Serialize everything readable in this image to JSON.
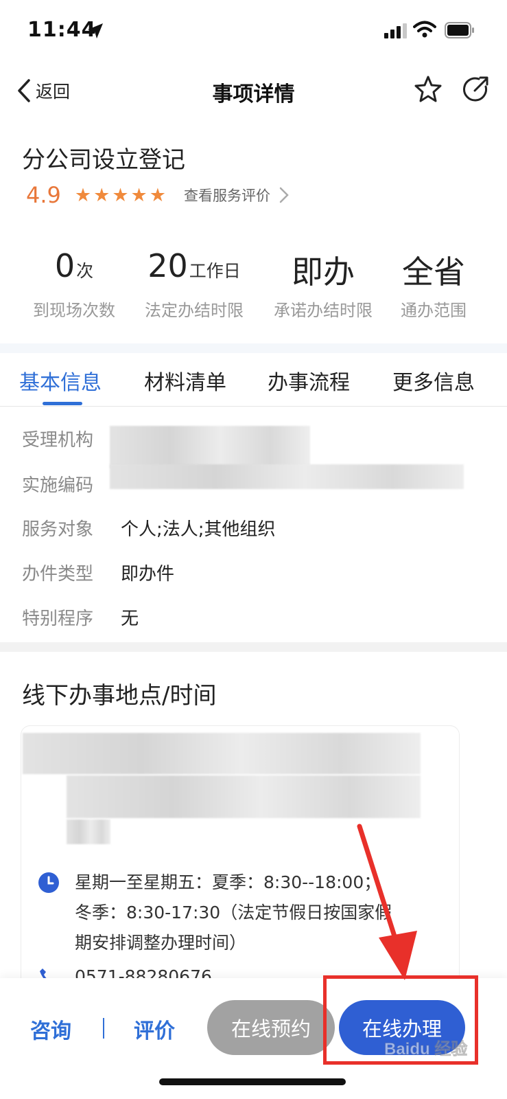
{
  "status_bar": {
    "time": "11:44"
  },
  "nav": {
    "back_label": "返回",
    "title": "事项详情"
  },
  "item": {
    "title": "分公司设立登记",
    "rating": "4.9",
    "star_count": 5,
    "review_link": "查看服务评价"
  },
  "stats": [
    {
      "value": "0",
      "unit": "次",
      "label": "到现场次数"
    },
    {
      "value": "20",
      "unit": "工作日",
      "label": "法定办结时限"
    },
    {
      "value": "即办",
      "unit": "",
      "label": "承诺办结时限"
    },
    {
      "value": "全省",
      "unit": "",
      "label": "通办范围"
    }
  ],
  "tabs": [
    {
      "label": "基本信息",
      "active": true
    },
    {
      "label": "材料清单",
      "active": false
    },
    {
      "label": "办事流程",
      "active": false
    },
    {
      "label": "更多信息",
      "active": false
    }
  ],
  "info": [
    {
      "label": "受理机构",
      "value": ""
    },
    {
      "label": "实施编码",
      "value": ""
    },
    {
      "label": "服务对象",
      "value": "个人;法人;其他组织"
    },
    {
      "label": "办件类型",
      "value": "即办件"
    },
    {
      "label": "特别程序",
      "value": "无"
    }
  ],
  "offline": {
    "title": "线下办事地点/时间",
    "hours_line1": "星期一至星期五：夏季：8:30--18:00；",
    "hours_line2": "冬季：8:30-17:30（法定节假日按国家假",
    "hours_line3": "期安排调整办理时间）",
    "phone": "0571-88280676"
  },
  "bottom_bar": {
    "consult_label": "咨询",
    "review_label": "评价",
    "book_label": "在线预约",
    "apply_label": "在线办理"
  },
  "watermark_text": "Baidu 经验",
  "colors": {
    "accent": "#2f6fd7",
    "rating": "#e8773a",
    "star": "#f08a3c",
    "disabled_button": "#a2a2a2",
    "annotation": "#e8302a"
  }
}
